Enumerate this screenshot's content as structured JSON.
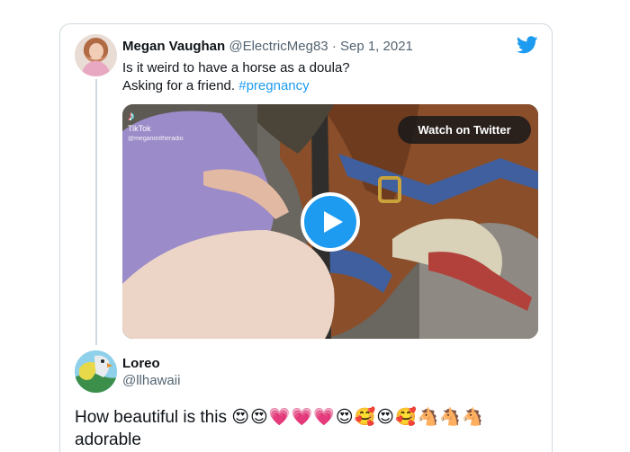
{
  "quoted_tweet": {
    "display_name": "Megan Vaughan",
    "handle": "@ElectricMeg83",
    "separator": "·",
    "date": "Sep 1, 2021",
    "text_line1": "Is it weird to have a horse as a doula?",
    "text_line2_prefix": "Asking for a friend.",
    "hashtag": "#pregnancy",
    "avatar_icon": "profile-photo",
    "logo_icon": "twitter-bird-icon"
  },
  "video": {
    "watch_label": "Watch on Twitter",
    "tiktok_label": "TikTok",
    "tiktok_handle": "@meganontheradio",
    "play_icon": "play-icon"
  },
  "reply": {
    "display_name": "Loreo",
    "handle": "@llhawaii",
    "text_line1": "How beautiful is this",
    "emojis": "😍😍💗💗💗😍🥰😍🥰🐴🐴🐴",
    "text_line2": "adorable"
  },
  "colors": {
    "accent": "#1d9bf0",
    "text_primary": "#0f1419",
    "text_secondary": "#536471",
    "border": "#cfd9de"
  }
}
